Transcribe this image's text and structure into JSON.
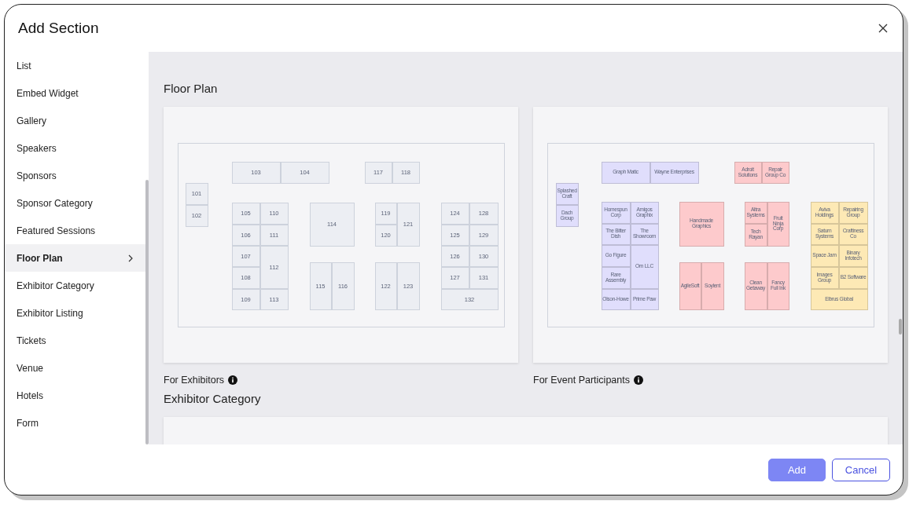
{
  "dialog": {
    "title": "Add Section"
  },
  "sidebar": {
    "items": [
      {
        "label": "List",
        "selected": false
      },
      {
        "label": "Embed Widget",
        "selected": false
      },
      {
        "label": "Gallery",
        "selected": false
      },
      {
        "label": "Speakers",
        "selected": false
      },
      {
        "label": "Sponsors",
        "selected": false
      },
      {
        "label": "Sponsor Category",
        "selected": false
      },
      {
        "label": "Featured Sessions",
        "selected": false
      },
      {
        "label": "Floor Plan",
        "selected": true
      },
      {
        "label": "Exhibitor Category",
        "selected": false
      },
      {
        "label": "Exhibitor Listing",
        "selected": false
      },
      {
        "label": "Tickets",
        "selected": false
      },
      {
        "label": "Venue",
        "selected": false
      },
      {
        "label": "Hotels",
        "selected": false
      },
      {
        "label": "Form",
        "selected": false
      }
    ]
  },
  "sections": [
    {
      "heading": "Floor Plan",
      "floor_plans": [
        {
          "caption": "For Exhibitors",
          "booths": [
            {
              "label": "101"
            },
            {
              "label": "102"
            },
            {
              "label": "103"
            },
            {
              "label": "104"
            },
            {
              "label": "117"
            },
            {
              "label": "118"
            },
            {
              "label": "105"
            },
            {
              "label": "110"
            },
            {
              "label": "106"
            },
            {
              "label": "111"
            },
            {
              "label": "107"
            },
            {
              "label": "108"
            },
            {
              "label": "112"
            },
            {
              "label": "109"
            },
            {
              "label": "113"
            },
            {
              "label": "114"
            },
            {
              "label": "115"
            },
            {
              "label": "116"
            },
            {
              "label": "119"
            },
            {
              "label": "120"
            },
            {
              "label": "121"
            },
            {
              "label": "122"
            },
            {
              "label": "123"
            },
            {
              "label": "124"
            },
            {
              "label": "128"
            },
            {
              "label": "125"
            },
            {
              "label": "129"
            },
            {
              "label": "126"
            },
            {
              "label": "130"
            },
            {
              "label": "127"
            },
            {
              "label": "131"
            },
            {
              "label": "132"
            }
          ]
        },
        {
          "caption": "For Event Participants",
          "booths": [
            {
              "label": "Splashed Craft",
              "color": "#e0defc"
            },
            {
              "label": "Dach Group",
              "color": "#e0defc"
            },
            {
              "label": "Graph Matic",
              "color": "#e0defc"
            },
            {
              "label": "Wayne Enterprises",
              "color": "#e0defc"
            },
            {
              "label": "Adroit Solutions",
              "color": "#fdcacc"
            },
            {
              "label": "Repair Group Co",
              "color": "#fdcacc"
            },
            {
              "label": "Homespun Corp",
              "color": "#e0defc"
            },
            {
              "label": "Amigos Graphix",
              "color": "#e0defc"
            },
            {
              "label": "The Bitter Dish",
              "color": "#e0defc"
            },
            {
              "label": "The Showroom",
              "color": "#e0defc"
            },
            {
              "label": "Go Figure",
              "color": "#e0defc"
            },
            {
              "label": "Rare Assembly",
              "color": "#e0defc"
            },
            {
              "label": "Orn LLC",
              "color": "#e0defc"
            },
            {
              "label": "Olson-Howe",
              "color": "#e0defc"
            },
            {
              "label": "Prime Paw",
              "color": "#e0defc"
            },
            {
              "label": "Handmade Graphics",
              "color": "#fdcacc"
            },
            {
              "label": "AgileSoft",
              "color": "#fdcacc"
            },
            {
              "label": "Soylent",
              "color": "#fdcacc"
            },
            {
              "label": "Altra Systems",
              "color": "#fdcacc"
            },
            {
              "label": "Tech Rayan",
              "color": "#fdcacc"
            },
            {
              "label": "Fruit Ninja Corp",
              "color": "#fdcacc"
            },
            {
              "label": "Clean Getaway",
              "color": "#fdcacc"
            },
            {
              "label": "Fancy Full Ink",
              "color": "#fdcacc"
            },
            {
              "label": "Aviva Holdings",
              "color": "#fde9b5"
            },
            {
              "label": "Repairing Group",
              "color": "#fde9b5"
            },
            {
              "label": "Saturn Systems",
              "color": "#fde9b5"
            },
            {
              "label": "Craftiness Co",
              "color": "#fde9b5"
            },
            {
              "label": "Space Jam",
              "color": "#fde9b5"
            },
            {
              "label": "Binary Infotech",
              "color": "#fde9b5"
            },
            {
              "label": "Images Group",
              "color": "#fde9b5"
            },
            {
              "label": "B2 Software",
              "color": "#fde9b5"
            },
            {
              "label": "Elbrus Global",
              "color": "#fde9b5"
            }
          ]
        }
      ]
    },
    {
      "heading": "Exhibitor Category"
    }
  ],
  "buttons": {
    "primary": "Add",
    "secondary": "Cancel"
  }
}
